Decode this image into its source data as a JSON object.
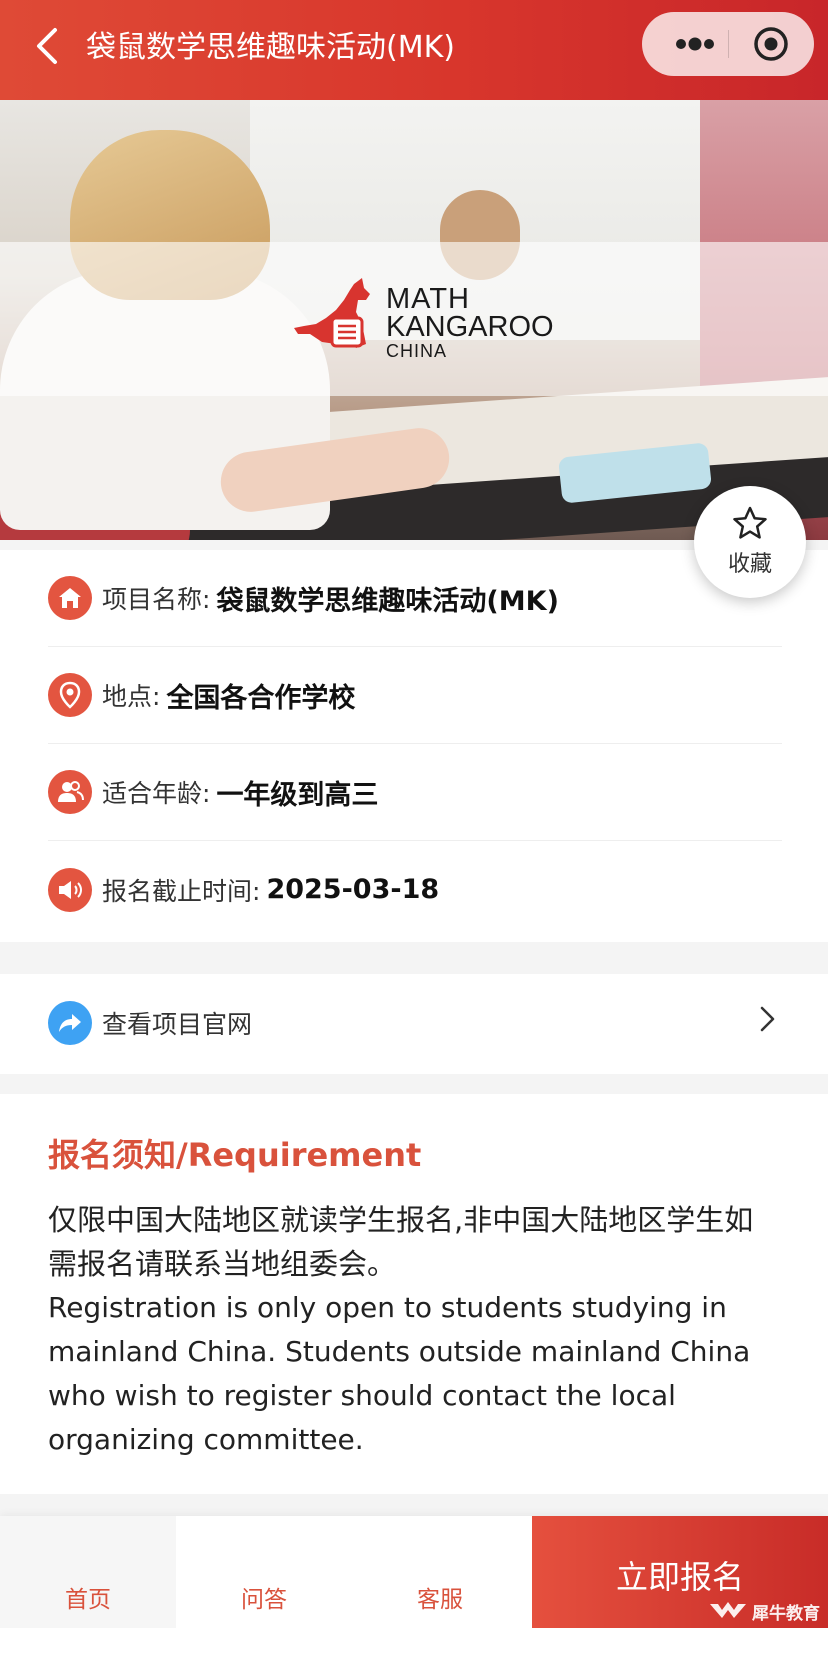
{
  "header": {
    "title": "袋鼠数学思维趣味活动(MK)"
  },
  "hero": {
    "logo_line1": "MATH",
    "logo_line2": "KANGAROO",
    "logo_line3": "CHINA"
  },
  "favorite": {
    "label": "收藏"
  },
  "info": {
    "rows": [
      {
        "icon": "home-icon",
        "key": "项目名称:",
        "value": "袋鼠数学思维趣味活动(MK)"
      },
      {
        "icon": "location-pin-icon",
        "key": "地点:",
        "value": "全国各合作学校"
      },
      {
        "icon": "users-icon",
        "key": "适合年龄:",
        "value": "一年级到高三"
      },
      {
        "icon": "speaker-icon",
        "key": "报名截止时间:",
        "value": "2025-03-18"
      }
    ]
  },
  "website_link": {
    "icon": "share-arrow-icon",
    "label": "查看项目官网"
  },
  "requirement": {
    "title": "报名须知/Requirement",
    "text_cn": "仅限中国大陆地区就读学生报名,非中国大陆地区学生如需报名请联系当地组委会。",
    "text_en": "Registration is only open to students studying in mainland China. Students outside mainland China who wish to register should contact the local organizing committee."
  },
  "tabbar": {
    "home": "首页",
    "qa": "问答",
    "service": "客服",
    "signup": "立即报名"
  },
  "watermark": "犀牛教育",
  "colors": {
    "brand_red": "#d8362c",
    "accent_orange_red": "#e35540",
    "link_blue": "#3ea2f3"
  }
}
